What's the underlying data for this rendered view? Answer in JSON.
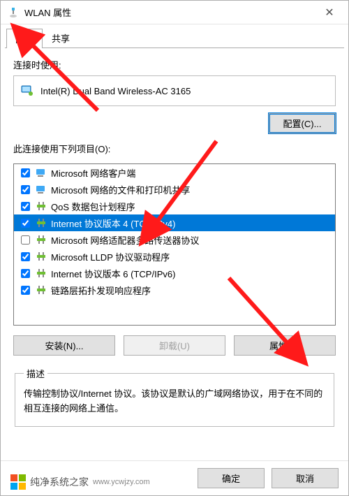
{
  "window": {
    "title": "WLAN 属性",
    "close_label": "✕"
  },
  "tabs": {
    "network": "网络",
    "sharing": "共享"
  },
  "connect_label": "连接时使用:",
  "adapter_name": "Intel(R) Dual Band Wireless-AC 3165",
  "configure_btn": "配置(C)...",
  "items_label": "此连接使用下列项目(O):",
  "items": [
    {
      "checked": true,
      "icon": "client",
      "label": "Microsoft 网络客户端"
    },
    {
      "checked": true,
      "icon": "client",
      "label": "Microsoft 网络的文件和打印机共享"
    },
    {
      "checked": true,
      "icon": "proto",
      "label": "QoS 数据包计划程序"
    },
    {
      "checked": true,
      "icon": "proto",
      "label": "Internet 协议版本 4 (TCP/IPv4)",
      "selected": true
    },
    {
      "checked": false,
      "icon": "proto",
      "label": "Microsoft 网络适配器多路传送器协议"
    },
    {
      "checked": true,
      "icon": "proto",
      "label": "Microsoft LLDP 协议驱动程序"
    },
    {
      "checked": true,
      "icon": "proto",
      "label": "Internet 协议版本 6 (TCP/IPv6)"
    },
    {
      "checked": true,
      "icon": "proto",
      "label": "链路层拓扑发现响应程序"
    }
  ],
  "buttons": {
    "install": "安装(N)...",
    "uninstall": "卸载(U)",
    "properties": "属性(R)"
  },
  "desc_group": "描述",
  "desc_text": "传输控制协议/Internet 协议。该协议是默认的广域网络协议，用于在不同的相互连接的网络上通信。",
  "footer": {
    "ok": "确定",
    "cancel": "取消"
  },
  "watermark": {
    "name": "纯净系统之家",
    "url": "www.ycwjzy.com"
  }
}
